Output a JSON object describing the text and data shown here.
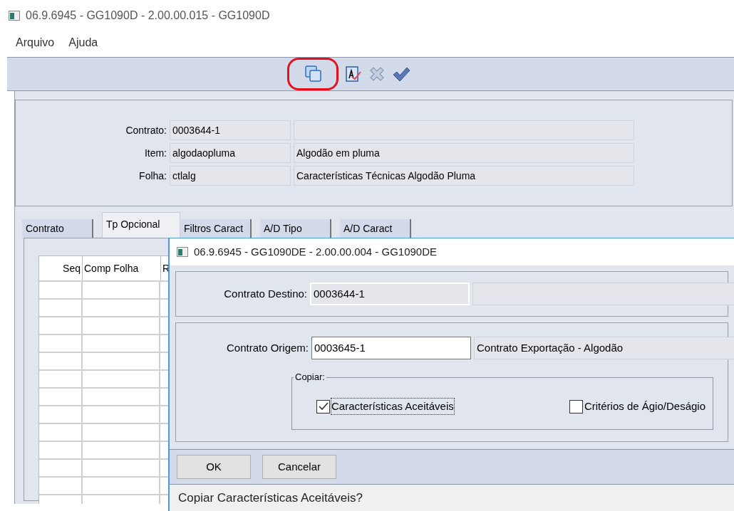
{
  "window": {
    "title": "06.9.6945 - GG1090D - 2.00.00.015 - GG1090D"
  },
  "menu": [
    "Arquivo",
    "Ajuda"
  ],
  "toolbar": [
    {
      "kind": "copy",
      "highlighted": true
    },
    {
      "kind": "edit",
      "highlighted": false
    },
    {
      "kind": "cancel",
      "highlighted": false
    },
    {
      "kind": "confirm",
      "highlighted": false
    }
  ],
  "header_fields": [
    {
      "label": "Contrato:",
      "code": "0003644-1"
    },
    {
      "label": "Item:",
      "code": "algodaopluma",
      "description": "Algodão em pluma"
    },
    {
      "label": "Folha:",
      "code": "ctlalg",
      "description": "Características Técnicas Algodão Pluma"
    }
  ],
  "tabs": [
    {
      "label": "Contrato",
      "selected": false
    },
    {
      "label": "Tp Opcional",
      "selected": true
    },
    {
      "label": "Filtros Caract",
      "selected": false
    },
    {
      "label": "A/D Tipo",
      "selected": false
    },
    {
      "label": "A/D Caract",
      "selected": false
    }
  ],
  "table": {
    "columns": [
      "Seq",
      "Comp Folha",
      "R"
    ]
  },
  "dialog": {
    "title": "06.9.6945 - GG1090DE - 2.00.00.004 - GG1090DE",
    "destino": {
      "label": "Contrato Destino:",
      "code": "0003644-1"
    },
    "origem": {
      "label": "Contrato Origem:",
      "code": "0003645-1",
      "description": "Contrato Exportação - Algodão"
    },
    "group_label": "Copiar:",
    "options": [
      {
        "label": "Características Aceitáveis",
        "checked": true
      },
      {
        "label": "Critérios de Ágio/Deságio",
        "checked": false
      }
    ],
    "buttons": [
      "OK",
      "Cancelar"
    ],
    "status": "Copiar Características Aceitáveis?"
  }
}
